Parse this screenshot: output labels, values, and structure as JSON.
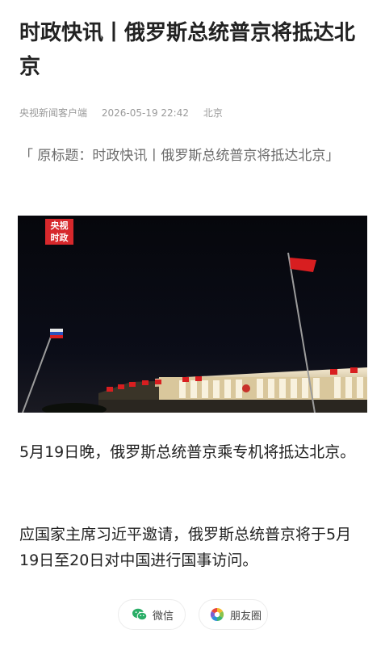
{
  "article": {
    "title": "时政快讯丨俄罗斯总统普京将抵达北京",
    "source": "央视新闻客户端",
    "datetime": "2026-05-19 22:42",
    "location": "北京",
    "original_title": "「 原标题：时政快讯丨俄罗斯总统普京将抵达北京」",
    "photo": {
      "logo_line1": "央视",
      "logo_line2": "时政"
    },
    "paragraphs": [
      "5月19日晚，俄罗斯总统普京乘专机将抵达北京。",
      "应国家主席习近平邀请，俄罗斯总统普京将于5月19日至20日对中国进行国事访问。"
    ]
  },
  "share": {
    "wechat_label": "微信",
    "wechat_icon": "wechat-icon",
    "moments_label": "朋友圈",
    "moments_icon": "moments-icon"
  },
  "colors": {
    "logo_red": "#d7282c",
    "flag_red": "#d81e20",
    "meta_gray": "#9a9a9a"
  }
}
